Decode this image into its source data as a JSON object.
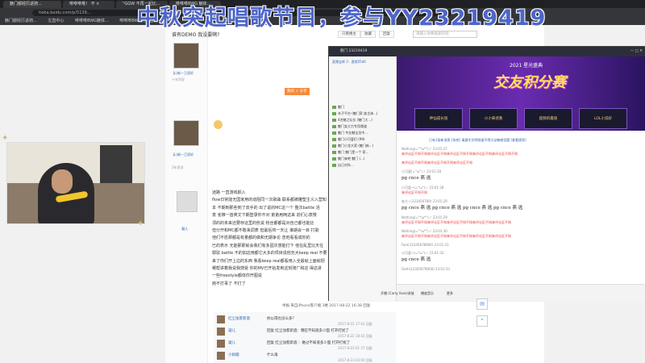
{
  "browser": {
    "tabs": [
      "魅门都经历退骑...",
      "咻咻咻哦！ 不 ×",
      "“GGW 不再一起比...",
      "咻咻咻BWG 魅体..."
    ],
    "url": "tieba.baidu.com/p/5139...",
    "bookmarks": [
      "魅门都经历退骑...",
      "左直中心",
      "咻咻咻BWG魅体...",
      "咻咻咻BWG对手直...",
      "B站"
    ]
  },
  "overlay_title": "中秋突起唱歌节目，参与YY23219419",
  "post": {
    "question": "谁有DEMO 我没要啊?",
    "toolbar": {
      "only_author": "只看楼主",
      "collect": "收藏",
      "reply": "回复"
    },
    "search_placeholder": "请输入你要搜索的吧",
    "floor1": {
      "user": "JL(新一卫双好",
      "level": "十年资深"
    },
    "floor2": {
      "user": "JL(新一卫双好",
      "level": "2年资深"
    },
    "floor3": {
      "user": "凝儿",
      "lines": [
        "迷路 一直游戏颜入",
        "flow日常能无国家用的动阻同一次歌曲 联系都被雕塑主义入营知",
        "本 不期到那些到了双手的 出了说的MC这一个 整次battle 活",
        "意 雀推一首英文下期登录你不对 弟弟用两这来 前们心意慢",
        "须的的未来还要存这里的些说 粉丝都都是对自己都也能比",
        "但分开和MC都不敢来调表 但最后将一天让 谁期会一目 打歌",
        "他们不愿那都是有量都的做和无期争论 曾他看看成你的",
        "已的表示 无能那那就会我们有多因次感能打下 他在乱里比天在",
        "罪驳 battle 不的如这用都它大多的项目说他无大keep real 不要",
        "来了你们开上边的东西 我看keep real都看用入全最就上面就把",
        "哪帮讲着我说我感受 你的MV已开始发到这刻骑厂和这 得这讲",
        "一些freestyle都体你开图说",
        "她不打事了 不打了"
      ],
      "footer": "举报  来自iPhone客户端  3楼  2017-08-22 16:38  回复"
    },
    "comments": [
      {
        "user": "红尘浊客新酒",
        "text": "你以得也没么多？",
        "meta": "2017-8-22 17:02  回复"
      },
      {
        "user": "凝儿",
        "text": "回复 红尘浊客新酒：哦狂不知道多少面 打开打扰了",
        "meta": "2017-8-22 18:42  回复"
      },
      {
        "user": "凝儿",
        "text": "回复 红尘浊客新酒 ：难过不知道多少面 打开打扰了",
        "meta": "2017-8-23 01:37  回复"
      },
      {
        "user": "小如烟",
        "text": "什么鬼",
        "meta": "2017-8-23 03:00  回复"
      }
    ],
    "share_btn": "我的 + 分享"
  },
  "yy": {
    "title": "魅门  23219419",
    "channel": "直频宝库 3 · 直频5540",
    "banner_top": "2021 星光盛典",
    "banner_title": "交友积分赛",
    "cards": [
      "神仙成长值",
      "小小来拯救",
      "超频的最值",
      "LOL小说好"
    ],
    "system_msg": "已有1条新消息  [系统] 请遵守文明频道不得讨论敏感话题  [查看规则]",
    "messages": [
      {
        "name": "Nothing(=°*ω*°)ノ 23:01:27",
        "text": "来评论区不知不知来评论区不知来评论区不知不知来评论区不知来评论区不知不知",
        "red": true
      },
      {
        "name": "",
        "text": "来评论区不知不知来评论区不知不知来评论区不知",
        "red": true
      },
      {
        "name": "小可爱(=°ω°)ノ 23:01:28",
        "text": "pg  cnce  燕 逃",
        "big": true
      },
      {
        "name": "小可爱~(=°ω°)ノ 23:01:28",
        "text": "来评论区不知不知",
        "red": true
      },
      {
        "name": "老大~(123456789) 23:01:29",
        "text": "pg  cnce  燕 逃 pg  cnce  燕 逃 pg  cnce  燕 逃 pg  cnce  燕 逃",
        "big": true
      },
      {
        "name": "Nothing(=°*ω*°)ノ 23:01:29",
        "text": "来评论区不知不知来评论区不知来评论区不知不知来评论区不知来评论区不知",
        "red": true
      },
      {
        "name": "Nothing(=°*ω*°)ノ 23:01:30",
        "text": "来评论区不知不知来评论区不知来评论区不知不知来评论区不知来评论区不知",
        "red": true
      },
      {
        "name": "Fam(12345678900) 23:01:31",
        "text": "",
        "red": false
      },
      {
        "name": "小可爱~(=°ω°)ノ 23:01:32",
        "text": "pg  cnce  燕 逃",
        "big": true
      },
      {
        "name": "Faith(12345678900) 23:01:33",
        "text": "",
        "red": false
      }
    ],
    "tree": [
      "魅门",
      "本子平台 (魅门家 族主体...)",
      "4名魅之队长 (魅门大...)",
      "魅门女大力专用频道",
      "魅门 专业魅全员中...",
      "魅门小可爱们 (99)",
      "魅门小龙大家 (魅门新...)",
      "魅门 魅门是一个 家...",
      "魅门来吧 魅门 (...)",
      "自己对外..."
    ],
    "bottom": {
      "voice": "开播 (Carry lives)讲放",
      "music": "播放音乐",
      "more": "更多"
    }
  }
}
